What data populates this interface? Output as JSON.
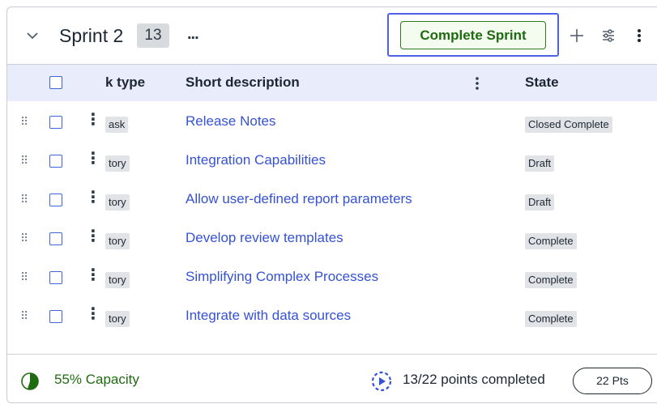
{
  "sprint": {
    "title": "Sprint 2",
    "count": "13",
    "more_label": "...",
    "complete_button": "Complete Sprint"
  },
  "icons": {
    "collapse": "chevron-down-icon",
    "add": "plus-icon",
    "filter": "sliders-icon",
    "more": "vertical-dots-icon"
  },
  "columns": {
    "type": "k type",
    "description": "Short description",
    "state": "State"
  },
  "rows": [
    {
      "type": "ask",
      "description": "Release Notes",
      "state": "Closed Complete"
    },
    {
      "type": "tory",
      "description": "Integration Capabilities",
      "state": "Draft"
    },
    {
      "type": "tory",
      "description": "Allow user-defined report parameters",
      "state": "Draft"
    },
    {
      "type": "tory",
      "description": "Develop review templates",
      "state": "Complete"
    },
    {
      "type": "tory",
      "description": "Simplifying Complex Processes",
      "state": "Complete"
    },
    {
      "type": "tory",
      "description": "Integrate with data sources",
      "state": "Complete"
    }
  ],
  "footer": {
    "capacity_label": "55% Capacity",
    "capacity_fraction": 0.55,
    "points_label": "13/22 points completed",
    "points_pill": "22 Pts"
  },
  "colors": {
    "accent_green": "#1f6b12",
    "link_blue": "#3552d6",
    "header_bg": "#e9ecfa",
    "focus_ring": "#4f61e6"
  }
}
